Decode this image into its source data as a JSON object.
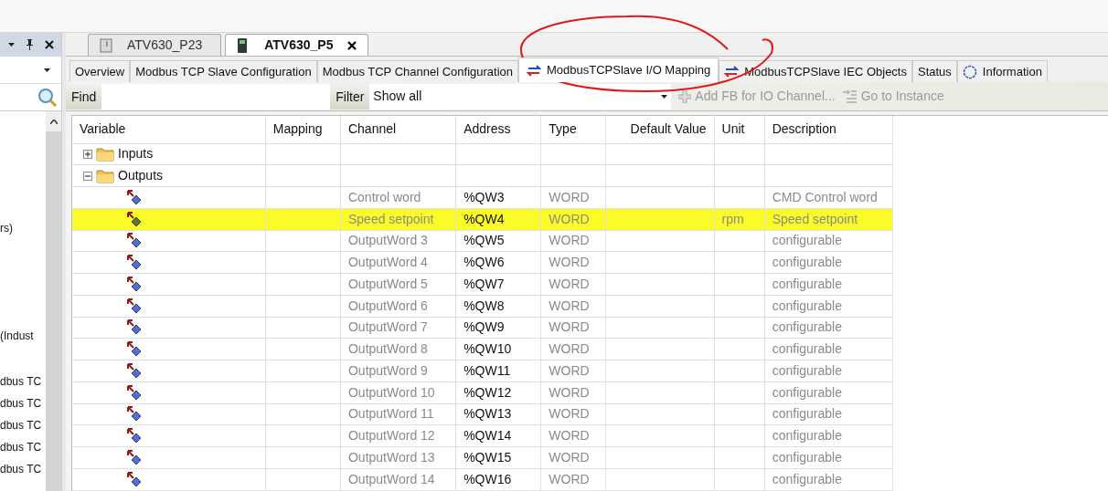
{
  "left_panel": {
    "items": [
      "rs)",
      "(Indust",
      "dbus TC",
      "dbus TC",
      "dbus TC",
      "dbus TC",
      "dbus TC"
    ]
  },
  "document_tabs": [
    {
      "label": "ATV630_P23",
      "selected": false
    },
    {
      "label": "ATV630_P5",
      "selected": true
    }
  ],
  "editor_tabs": [
    {
      "label": "Overview",
      "selected": false,
      "kind": "plain"
    },
    {
      "label": "Modbus TCP Slave Configuration",
      "selected": false,
      "kind": "plain"
    },
    {
      "label": "Modbus TCP Channel Configuration",
      "selected": false,
      "kind": "plain"
    },
    {
      "label": "ModbusTCPSlave I/O Mapping",
      "selected": true,
      "kind": "mapping"
    },
    {
      "label": "ModbusTCPSlave IEC Objects",
      "selected": false,
      "kind": "mapping"
    },
    {
      "label": "Status",
      "selected": false,
      "kind": "plain"
    },
    {
      "label": "Information",
      "selected": false,
      "kind": "info"
    }
  ],
  "toolbar": {
    "find_label": "Find",
    "filter_label": "Filter",
    "filter_value": "Show all",
    "actions": [
      {
        "label": "Add FB for IO Channel...",
        "disabled": true,
        "kind": "add"
      },
      {
        "label": "Go to Instance",
        "disabled": true,
        "kind": "goto"
      }
    ]
  },
  "table": {
    "columns": [
      "Variable",
      "Mapping",
      "Channel",
      "Address",
      "Type",
      "Default Value",
      "Unit",
      "Description"
    ],
    "tree": [
      {
        "label": "Inputs",
        "expanded": false
      },
      {
        "label": "Outputs",
        "expanded": true,
        "children": [
          {
            "channel": "Control word",
            "address": "%QW3",
            "type": "WORD",
            "description": "CMD Control word",
            "highlighted": false
          },
          {
            "channel": "Speed setpoint",
            "address": "%QW4",
            "type": "WORD",
            "unit": "rpm",
            "description": "Speed setpoint",
            "highlighted": true
          },
          {
            "channel": "OutputWord 3",
            "address": "%QW5",
            "type": "WORD",
            "description": "configurable",
            "highlighted": false
          },
          {
            "channel": "OutputWord 4",
            "address": "%QW6",
            "type": "WORD",
            "description": "configurable",
            "highlighted": false
          },
          {
            "channel": "OutputWord 5",
            "address": "%QW7",
            "type": "WORD",
            "description": "configurable",
            "highlighted": false
          },
          {
            "channel": "OutputWord 6",
            "address": "%QW8",
            "type": "WORD",
            "description": "configurable",
            "highlighted": false
          },
          {
            "channel": "OutputWord 7",
            "address": "%QW9",
            "type": "WORD",
            "description": "configurable",
            "highlighted": false
          },
          {
            "channel": "OutputWord 8",
            "address": "%QW10",
            "type": "WORD",
            "description": "configurable",
            "highlighted": false
          },
          {
            "channel": "OutputWord 9",
            "address": "%QW11",
            "type": "WORD",
            "description": "configurable",
            "highlighted": false
          },
          {
            "channel": "OutputWord 10",
            "address": "%QW12",
            "type": "WORD",
            "description": "configurable",
            "highlighted": false
          },
          {
            "channel": "OutputWord 11",
            "address": "%QW13",
            "type": "WORD",
            "description": "configurable",
            "highlighted": false
          },
          {
            "channel": "OutputWord 12",
            "address": "%QW14",
            "type": "WORD",
            "description": "configurable",
            "highlighted": false
          },
          {
            "channel": "OutputWord 13",
            "address": "%QW15",
            "type": "WORD",
            "description": "configurable",
            "highlighted": false
          },
          {
            "channel": "OutputWord 14",
            "address": "%QW16",
            "type": "WORD",
            "description": "configurable",
            "highlighted": false
          }
        ]
      }
    ]
  }
}
